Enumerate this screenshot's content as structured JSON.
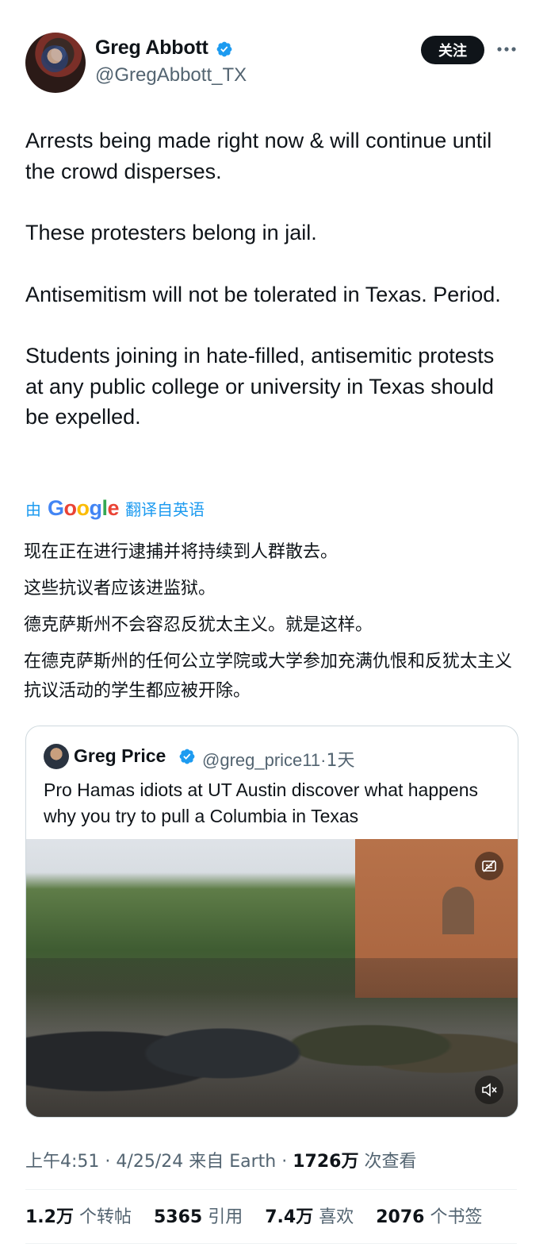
{
  "author": {
    "name": "Greg Abbott",
    "handle": "@GregAbbott_TX",
    "follow_label": "关注"
  },
  "tweet": {
    "paragraphs": [
      "Arrests being made right now & will continue until the crowd disperses.",
      "These protesters belong in jail.",
      "Antisemitism will not be tolerated in Texas. Period.",
      "Students joining in hate-filled, antisemitic protests at any public college or university in Texas should be expelled."
    ]
  },
  "translation": {
    "prefix": "由",
    "provider": "Google",
    "suffix": "翻译自英语",
    "lines": [
      "现在正在进行逮捕并将持续到人群散去。",
      "这些抗议者应该进监狱。",
      "德克萨斯州不会容忍反犹太主义。就是这样。",
      "在德克萨斯州的任何公立学院或大学参加充满仇恨和反犹太主义抗议活动的学生都应被开除。"
    ]
  },
  "quote": {
    "name": "Greg Price",
    "handle": "@greg_price11",
    "time": "1天",
    "text": "Pro Hamas idiots at UT Austin discover what happens why you try to pull a Columbia in Texas"
  },
  "meta": {
    "time": "上午4:51",
    "date": "4/25/24",
    "source": "来自 Earth",
    "views": "1726万",
    "views_label": "次查看"
  },
  "stats": {
    "retweets": "1.2万",
    "retweets_label": "个转帖",
    "quotes": "5365",
    "quotes_label": "引用",
    "likes": "7.4万",
    "likes_label": "喜欢",
    "bookmarks": "2076",
    "bookmarks_label": "个书签"
  },
  "colors": {
    "verified": "#1d9bf0",
    "link": "#1d9bf0",
    "secondary_text": "#536471"
  },
  "icons": [
    "verified-badge-icon",
    "more-icon",
    "captions-icon",
    "mute-icon"
  ]
}
